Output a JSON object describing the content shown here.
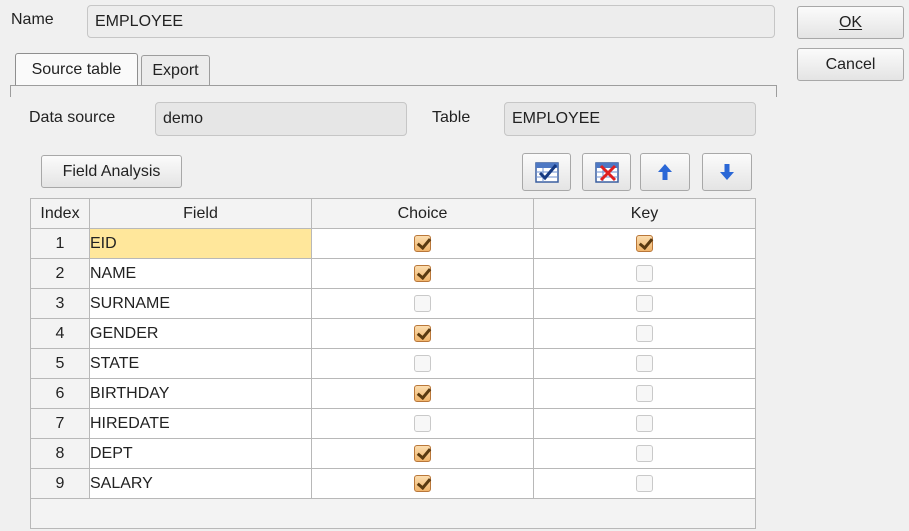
{
  "name_label": "Name",
  "name_value": "EMPLOYEE",
  "buttons": {
    "ok": "OK",
    "cancel": "Cancel",
    "field_analysis": "Field Analysis"
  },
  "tabs": [
    {
      "label": "Source table",
      "active": true
    },
    {
      "label": "Export",
      "active": false
    }
  ],
  "data_source": {
    "label": "Data source",
    "value": "demo"
  },
  "table": {
    "label": "Table",
    "value": "EMPLOYEE"
  },
  "toolbar_icons": [
    "select-all-icon",
    "deselect-all-icon",
    "move-up-icon",
    "move-down-icon"
  ],
  "grid": {
    "columns": [
      "Index",
      "Field",
      "Choice",
      "Key"
    ],
    "rows": [
      {
        "index": "1",
        "field": "EID",
        "choice": true,
        "key": true,
        "selected": true
      },
      {
        "index": "2",
        "field": "NAME",
        "choice": true,
        "key": false
      },
      {
        "index": "3",
        "field": "SURNAME",
        "choice": false,
        "key": false
      },
      {
        "index": "4",
        "field": "GENDER",
        "choice": true,
        "key": false
      },
      {
        "index": "5",
        "field": "STATE",
        "choice": false,
        "key": false
      },
      {
        "index": "6",
        "field": "BIRTHDAY",
        "choice": true,
        "key": false
      },
      {
        "index": "7",
        "field": "HIREDATE",
        "choice": false,
        "key": false
      },
      {
        "index": "8",
        "field": "DEPT",
        "choice": true,
        "key": false
      },
      {
        "index": "9",
        "field": "SALARY",
        "choice": true,
        "key": false
      }
    ]
  },
  "colors": {
    "selected_cell": "#ffe79b",
    "checkbox_on": "#f1b56c",
    "arrow_blue": "#2a67d6"
  }
}
